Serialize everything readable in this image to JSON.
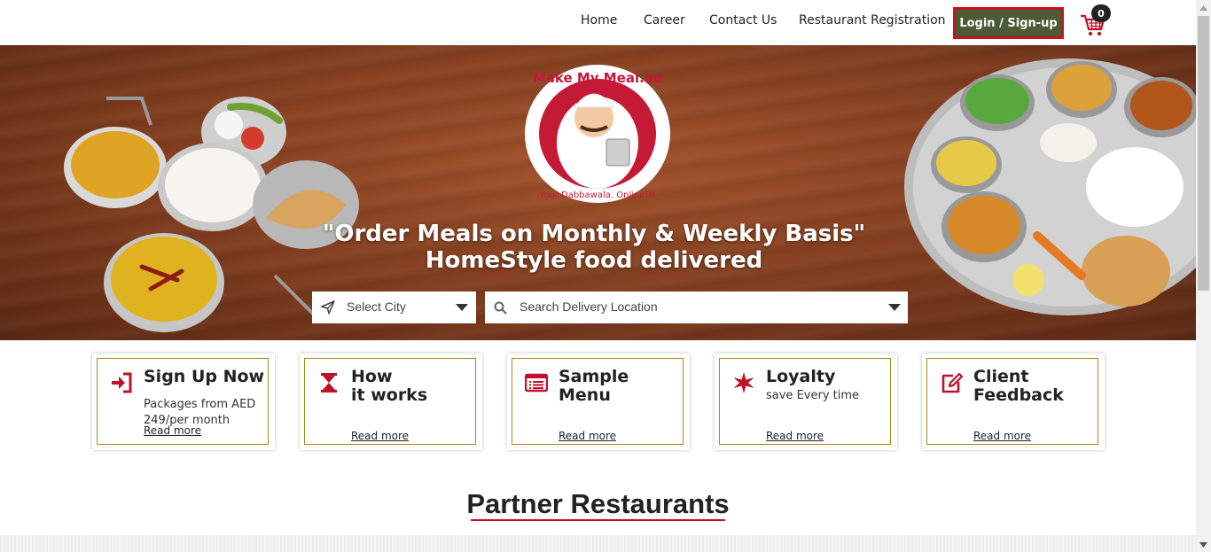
{
  "nav": {
    "items": [
      {
        "label": "Home"
      },
      {
        "label": "Career"
      },
      {
        "label": "Contact Us"
      },
      {
        "label": "Restaurant Registration"
      }
    ],
    "login_label": "Login / Sign-up",
    "cart_count": "0",
    "cart_icon": "shopping-cart-icon"
  },
  "hero": {
    "logo_text": "Make My Meal.ae",
    "logo_tagline": "Your Dabbawala. Online!!!",
    "headline": "\"Order Meals on Monthly & Weekly Basis\"",
    "subheadline": "HomeStyle food delivered",
    "city_placeholder": "Select City",
    "location_placeholder": "Search Delivery Location"
  },
  "cards": [
    {
      "title": "Sign Up Now",
      "desc": "Packages from AED 249/per month",
      "link": "Read more",
      "icon": "sign-in-icon"
    },
    {
      "title": "How\nit works",
      "desc": "",
      "link": "Read more",
      "icon": "hourglass-icon"
    },
    {
      "title": "Sample\nMenu",
      "desc": "",
      "link": "Read more",
      "icon": "menu-list-icon"
    },
    {
      "title": "Loyalty",
      "desc": "save Every time",
      "link": "Read more",
      "icon": "star-icon"
    },
    {
      "title": "Client\nFeedback",
      "desc": "",
      "link": "Read more",
      "icon": "edit-icon"
    }
  ],
  "partners": {
    "title": "Partner Restaurants"
  },
  "colors": {
    "accent": "#c2102b",
    "login_bg": "#4c5a35",
    "login_border": "#d0101b",
    "card_border": "#a88a1a"
  }
}
